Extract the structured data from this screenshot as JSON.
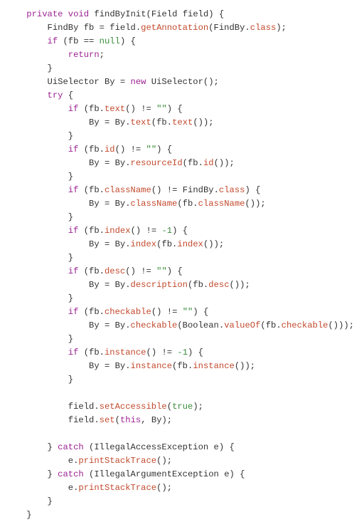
{
  "code": {
    "t": [
      "    ",
      "private",
      " ",
      "void",
      " findByInit(Field field) {",
      "\n        FindBy fb = field.",
      "getAnnotation",
      "(FindBy.",
      "class",
      ");",
      "\n        ",
      "if",
      " (fb == ",
      "null",
      ") {",
      "\n            ",
      "return",
      ";",
      "\n        }",
      "\n        UiSelector By = ",
      "new",
      " UiSelector();",
      "\n        ",
      "try",
      " {",
      "\n            ",
      "if",
      " (fb.",
      "text",
      "() != ",
      "\"\"",
      ") {",
      "\n                By = By.",
      "text",
      "(fb.",
      "text",
      "());",
      "\n            }",
      "\n            ",
      "if",
      " (fb.",
      "id",
      "() != ",
      "\"\"",
      ") {",
      "\n                By = By.",
      "resourceId",
      "(fb.",
      "id",
      "());",
      "\n            }",
      "\n            ",
      "if",
      " (fb.",
      "className",
      "() != FindBy.",
      "class",
      ") {",
      "\n                By = By.",
      "className",
      "(fb.",
      "className",
      "());",
      "\n            }",
      "\n            ",
      "if",
      " (fb.",
      "index",
      "() != ",
      "-1",
      ") {",
      "\n                By = By.",
      "index",
      "(fb.",
      "index",
      "());",
      "\n            }",
      "\n            ",
      "if",
      " (fb.",
      "desc",
      "() != ",
      "\"\"",
      ") {",
      "\n                By = By.",
      "description",
      "(fb.",
      "desc",
      "());",
      "\n            }",
      "\n            ",
      "if",
      " (fb.",
      "checkable",
      "() != ",
      "\"\"",
      ") {",
      "\n                By = By.",
      "checkable",
      "(Boolean.",
      "valueOf",
      "(fb.",
      "checkable",
      "()));",
      "\n            }",
      "\n            ",
      "if",
      " (fb.",
      "instance",
      "() != ",
      "-1",
      ") {",
      "\n                By = By.",
      "instance",
      "(fb.",
      "instance",
      "());",
      "\n            }",
      "\n",
      "\n            field.",
      "setAccessible",
      "(",
      "true",
      ");",
      "\n            field.",
      "set",
      "(",
      "this",
      ", By);",
      "\n",
      "\n        } ",
      "catch",
      " (IllegalAccessException e) {",
      "\n            e.",
      "printStackTrace",
      "();",
      "\n        } ",
      "catch",
      " (IllegalArgumentException e) {",
      "\n            e.",
      "printStackTrace",
      "();",
      "\n        }",
      "\n    }",
      "\n",
      "\n}"
    ],
    "c": [
      "",
      "kw",
      "",
      "kw",
      "",
      "",
      "mthd",
      "",
      "cls",
      "",
      "",
      "kw",
      "",
      "lit",
      "",
      "",
      "kw",
      "",
      "",
      "",
      "kw",
      "",
      "",
      "kw",
      "",
      "",
      "kw",
      "",
      "mthd",
      "",
      "str",
      "",
      "",
      "mthd",
      "",
      "mthd",
      "",
      "",
      "",
      "kw",
      "",
      "mthd",
      "",
      "str",
      "",
      "",
      "mthd",
      "",
      "mthd",
      "",
      "",
      "",
      "kw",
      "",
      "mthd",
      "",
      "cls",
      "",
      "",
      "mthd",
      "",
      "mthd",
      "",
      "",
      "",
      "kw",
      "",
      "mthd",
      "",
      "lit",
      "",
      "",
      "mthd",
      "",
      "mthd",
      "",
      "",
      "",
      "kw",
      "",
      "mthd",
      "",
      "str",
      "",
      "",
      "mthd",
      "",
      "mthd",
      "",
      "",
      "",
      "kw",
      "",
      "mthd",
      "",
      "str",
      "",
      "",
      "mthd",
      "",
      "mthd",
      "",
      "mthd",
      "",
      "",
      "",
      "kw",
      "",
      "mthd",
      "",
      "lit",
      "",
      "",
      "mthd",
      "",
      "mthd",
      "",
      "",
      "",
      "",
      "mthd",
      "",
      "lit",
      "",
      "",
      "mthd",
      "",
      "kw",
      "",
      "",
      "",
      "kw",
      "",
      "",
      "mthd",
      "",
      "",
      "kw",
      "",
      "",
      "mthd",
      "",
      "",
      "",
      "",
      ""
    ]
  }
}
